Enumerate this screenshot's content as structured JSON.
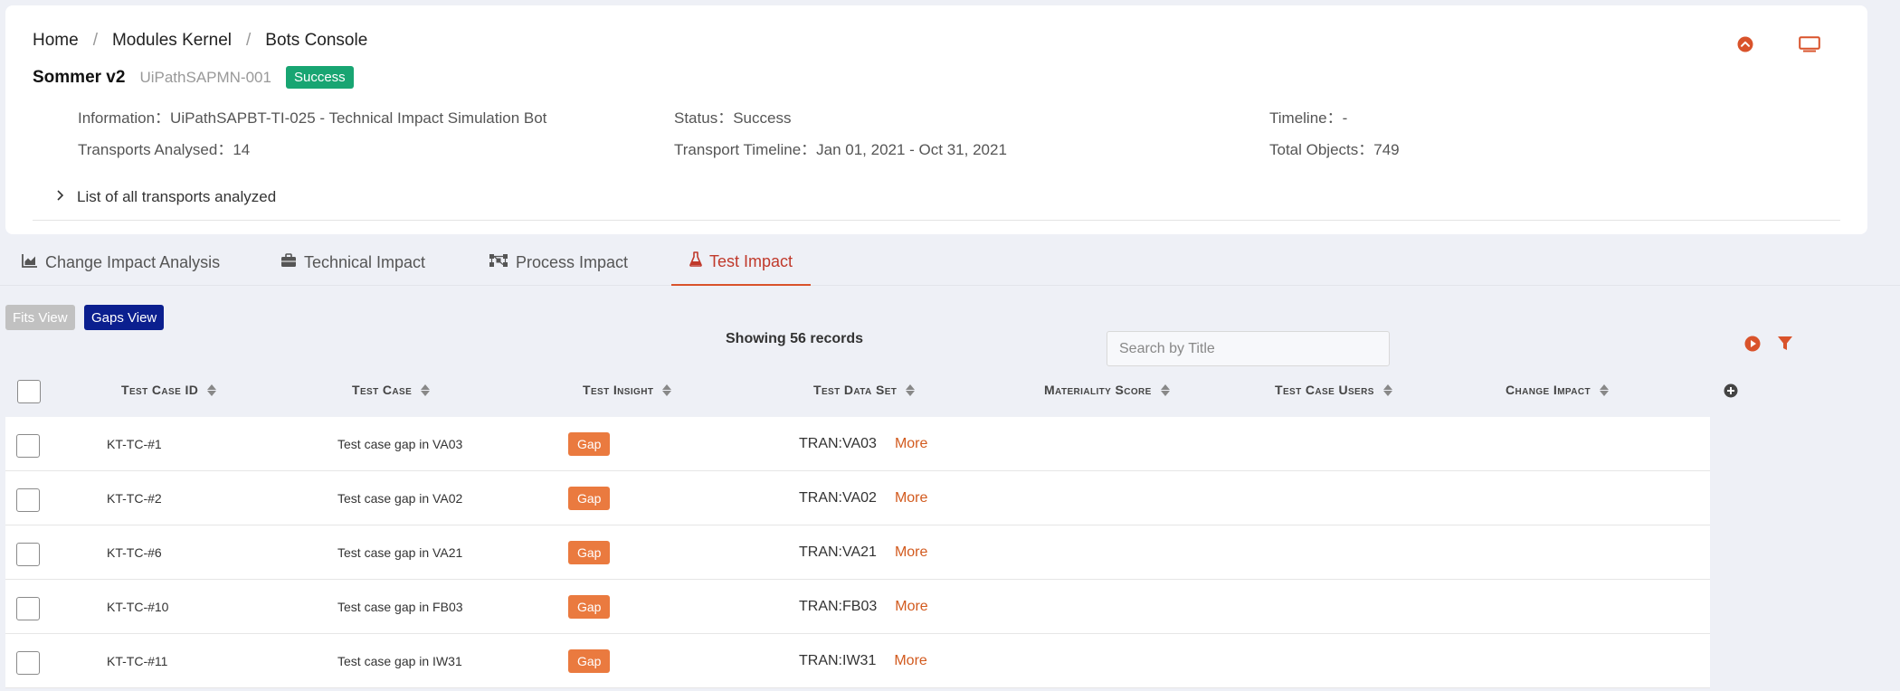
{
  "breadcrumb": {
    "items": [
      "Home",
      "Modules Kernel",
      "Bots Console"
    ],
    "separator": "/"
  },
  "header": {
    "bot_name": "Sommer v2",
    "bot_id": "UiPathSAPMN-001",
    "status_badge": "Success",
    "icons": [
      "chevron-up-circle-icon",
      "monitor-icon"
    ]
  },
  "info": {
    "information": "Information：UiPathSAPBT-TI-025 - Technical Impact Simulation Bot",
    "transports_analysed": "Transports Analysed：14",
    "status": "Status：Success",
    "transport_timeline": "Transport Timeline：Jan 01, 2021 - Oct 31, 2021",
    "timeline": "Timeline：-",
    "total_objects": "Total Objects：749"
  },
  "transports_toggle": "List of all transports analyzed",
  "tabs": [
    {
      "label": "Change Impact Analysis",
      "icon": "area-chart-icon"
    },
    {
      "label": "Technical Impact",
      "icon": "briefcase-icon"
    },
    {
      "label": "Process Impact",
      "icon": "nodes-icon"
    },
    {
      "label": "Test Impact",
      "icon": "flask-icon",
      "active": true
    }
  ],
  "views": {
    "fits": "Fits View",
    "gaps": "Gaps View"
  },
  "records_text": "Showing 56 records",
  "search": {
    "placeholder": "Search by Title",
    "value": ""
  },
  "columns": [
    "Test Case ID",
    "Test Case",
    "Test Insight",
    "Test Data Set",
    "Materiality Score",
    "Test Case Users",
    "Change Impact"
  ],
  "rows": [
    {
      "id": "KT-TC-#1",
      "test_case": "Test case gap in VA03",
      "insight": "Gap",
      "dataset": "TRAN:VA03",
      "more": "More"
    },
    {
      "id": "KT-TC-#2",
      "test_case": "Test case gap in VA02",
      "insight": "Gap",
      "dataset": "TRAN:VA02",
      "more": "More"
    },
    {
      "id": "KT-TC-#6",
      "test_case": "Test case gap in VA21",
      "insight": "Gap",
      "dataset": "TRAN:VA21",
      "more": "More"
    },
    {
      "id": "KT-TC-#10",
      "test_case": "Test case gap in FB03",
      "insight": "Gap",
      "dataset": "TRAN:FB03",
      "more": "More"
    },
    {
      "id": "KT-TC-#11",
      "test_case": "Test case gap in IW31",
      "insight": "Gap",
      "dataset": "TRAN:IW31",
      "more": "More"
    }
  ],
  "colors": {
    "accent": "#d9532b",
    "success": "#18a572",
    "gap": "#ea7a3f",
    "primary": "#0b1f8f"
  }
}
